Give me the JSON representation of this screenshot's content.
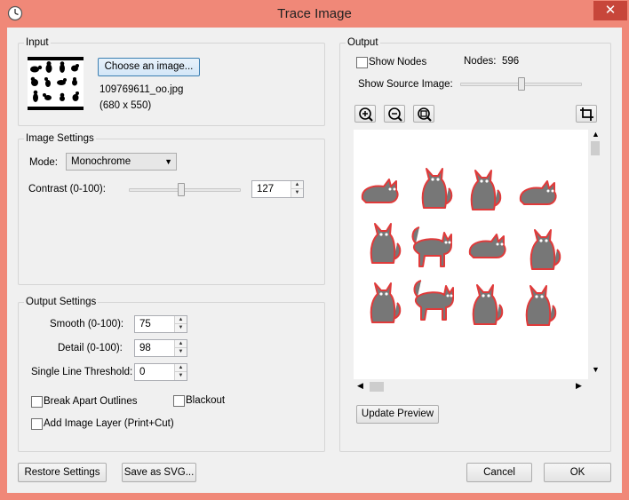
{
  "window": {
    "title": "Trace Image",
    "close_glyph": "✕",
    "close_icon": "close-icon",
    "app_icon": "clock-icon"
  },
  "input": {
    "title": "Input",
    "choose_label": "Choose an image...",
    "filename": "109769611_oo.jpg",
    "dimensions": "(680 x 550)"
  },
  "image_settings": {
    "title": "Image Settings",
    "mode_label": "Mode:",
    "mode_value": "Monochrome",
    "contrast_label": "Contrast (0-100):",
    "contrast_value": "127",
    "contrast_fraction": 0.47
  },
  "output_settings": {
    "title": "Output Settings",
    "smooth_label": "Smooth (0-100):",
    "smooth_value": "75",
    "detail_label": "Detail (0-100):",
    "detail_value": "98",
    "threshold_label": "Single Line Threshold:",
    "threshold_value": "0",
    "break_apart_label": "Break Apart Outlines",
    "blackout_label": "Blackout",
    "add_layer_label": "Add Image Layer (Print+Cut)"
  },
  "output": {
    "title": "Output",
    "show_nodes_label": "Show Nodes",
    "nodes_label": "Nodes:",
    "nodes_value": "596",
    "show_source_label": "Show Source Image:",
    "source_fraction": 0.5,
    "update_label": "Update Preview",
    "zoom_in_icon": "zoom-in-icon",
    "zoom_out_icon": "zoom-out-icon",
    "zoom_fit_icon": "zoom-fit-icon",
    "crop_icon": "crop-icon"
  },
  "footer": {
    "restore_label": "Restore Settings",
    "save_svg_label": "Save as SVG...",
    "cancel_label": "Cancel",
    "ok_label": "OK"
  },
  "colors": {
    "titlebar": "#f08878",
    "close": "#c7463a",
    "trace_fill": "#777777",
    "trace_outline": "#e03a3a"
  }
}
